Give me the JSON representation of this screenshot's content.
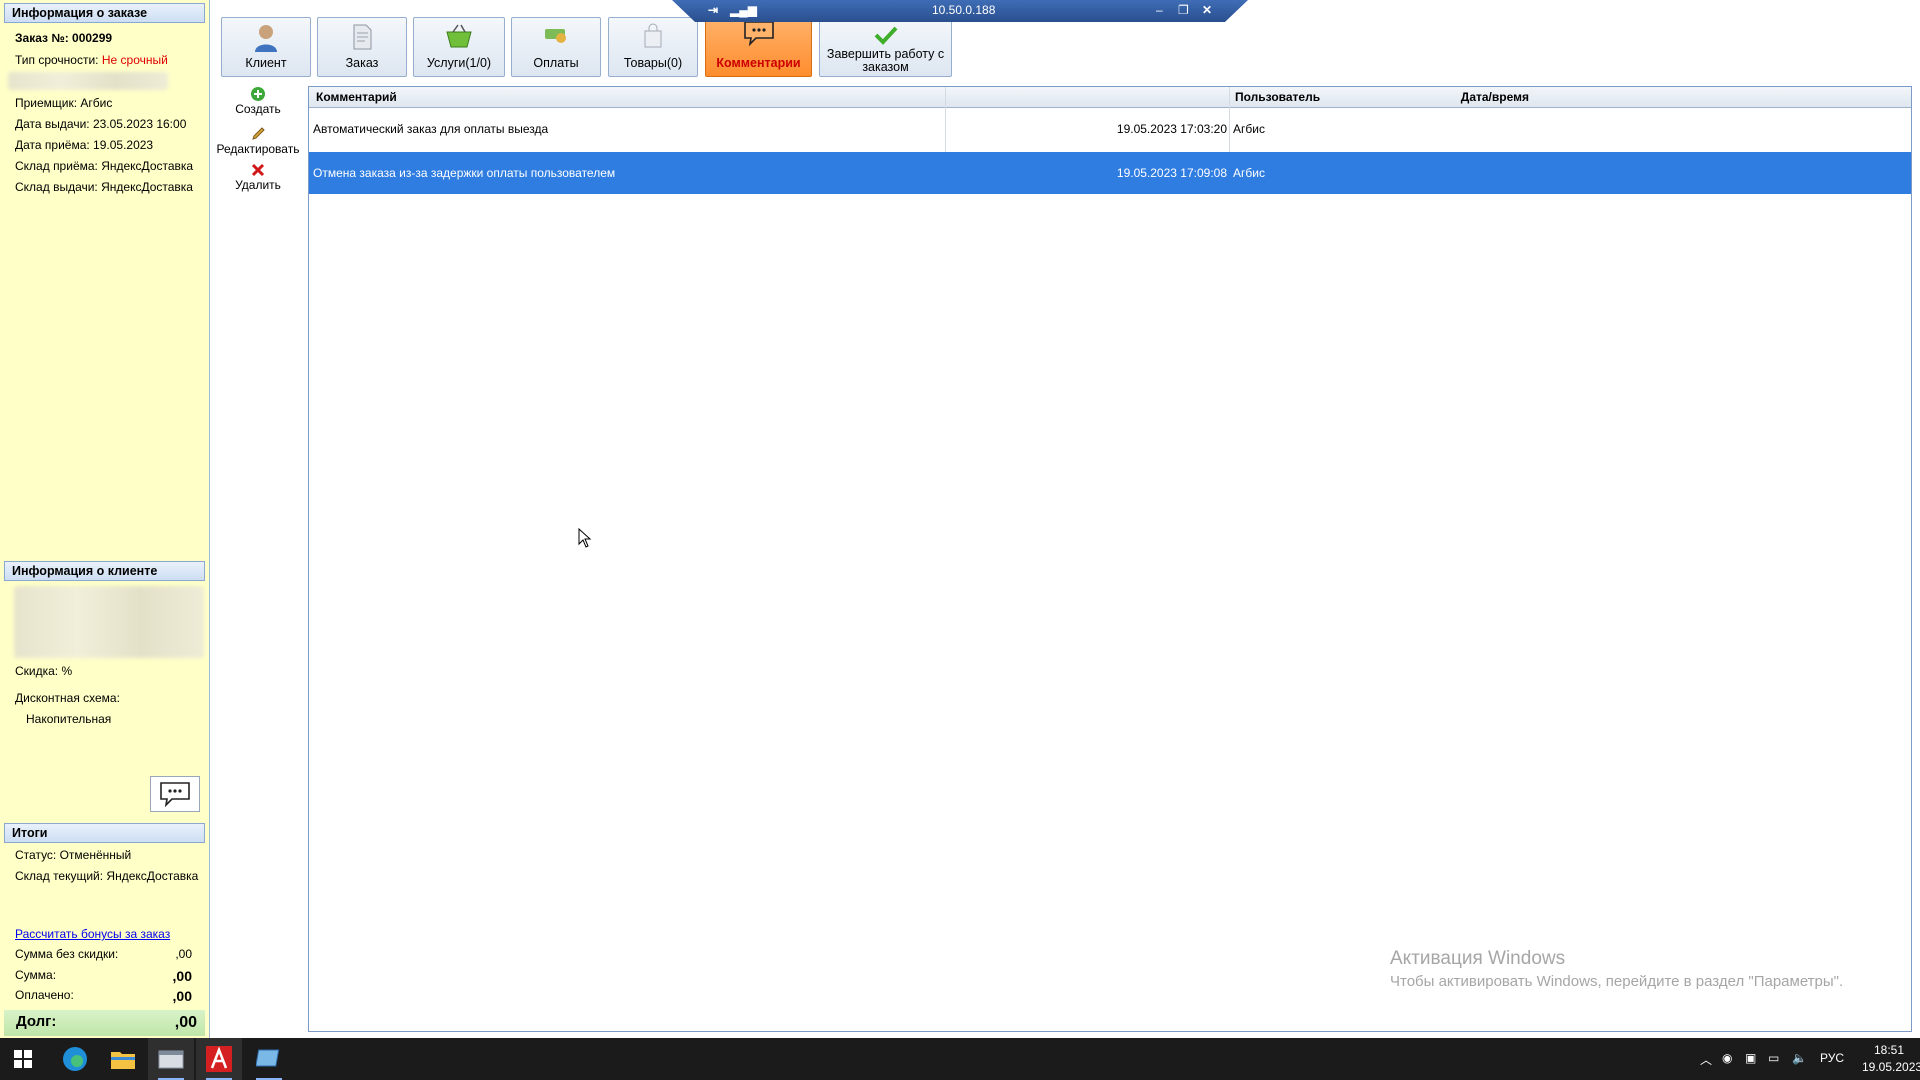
{
  "order_info": {
    "header": "Информация о заказе",
    "order_number": "Заказ №: 000299",
    "urgency_label": "Тип срочности:",
    "urgency_value": "Не срочный",
    "receiver": "Приемщик: Агбис",
    "issue_date": "Дата выдачи: 23.05.2023 16:00",
    "accept_date": "Дата приёма: 19.05.2023",
    "warehouse_accept": "Склад приёма: ЯндексДоставка",
    "warehouse_issue": "Склад выдачи: ЯндексДоставка"
  },
  "client_info": {
    "header": "Информация о клиенте",
    "discount": "Скидка: %",
    "discount_scheme_label": "Дисконтная схема:",
    "discount_scheme_value": "Накопительная"
  },
  "totals": {
    "header": "Итоги",
    "status": "Статус: Отменённый",
    "current_warehouse": "Склад текущий: ЯндексДоставка",
    "bonus_link": "Рассчитать бонусы за заказ",
    "sum_no_discount_label": "Сумма без скидки:",
    "sum_no_discount_value": ",00",
    "sum_label": "Сумма:",
    "sum_value": ",00",
    "paid_label": "Оплачено:",
    "paid_value": ",00",
    "debt_label": "Долг:",
    "debt_value": ",00"
  },
  "toolbar": {
    "client": "Клиент",
    "order": "Заказ",
    "services": "Услуги(1/0)",
    "payments": "Оплаты",
    "goods": "Товары(0)",
    "comments": "Комментарии",
    "finish_line1": "Завершить работу с",
    "finish_line2": "заказом"
  },
  "remote_session": {
    "address": "10.50.0.188"
  },
  "actions": {
    "create": "Создать",
    "edit": "Редактировать",
    "delete": "Удалить"
  },
  "grid": {
    "columns": [
      "Комментарий",
      "Дата/время",
      "Пользователь"
    ],
    "rows": [
      {
        "comment": "Автоматический заказ для оплаты выезда",
        "datetime": "19.05.2023 17:03:20",
        "user": "Агбис",
        "selected": false
      },
      {
        "comment": "Отмена заказа из-за задержки оплаты пользователем",
        "datetime": "19.05.2023 17:09:08",
        "user": "Агбис",
        "selected": true
      }
    ]
  },
  "watermark": {
    "title": "Активация Windows",
    "subtitle": "Чтобы активировать Windows, перейдите в раздел \"Параметры\"."
  },
  "taskbar": {
    "language": "РУС",
    "time": "18:51",
    "date": "19.05.2023",
    "apps": [
      "start-icon",
      "edge-icon",
      "file-explorer-icon",
      "app-window-icon",
      "agbis-icon",
      "remote-app-icon"
    ]
  },
  "colors": {
    "panel_bg": "#ffffc8",
    "selected_row": "#2f7de1",
    "active_tab": "#ff8d2e",
    "urgency_red": "#e00000"
  }
}
